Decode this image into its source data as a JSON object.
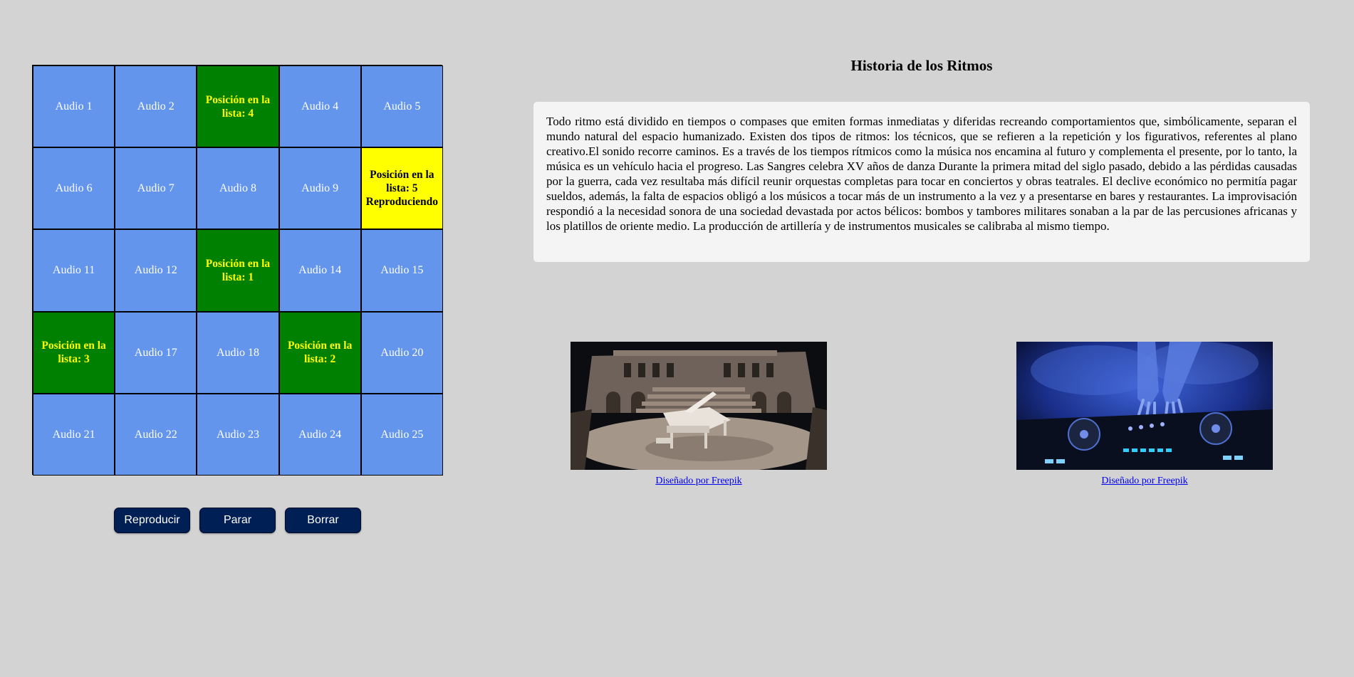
{
  "grid": {
    "cells": [
      {
        "lines": [
          "Audio 1"
        ],
        "state": "idle"
      },
      {
        "lines": [
          "Audio 2"
        ],
        "state": "idle"
      },
      {
        "lines": [
          "Posición en la",
          "lista: 4"
        ],
        "state": "queued"
      },
      {
        "lines": [
          "Audio 4"
        ],
        "state": "idle"
      },
      {
        "lines": [
          "Audio 5"
        ],
        "state": "idle"
      },
      {
        "lines": [
          "Audio 6"
        ],
        "state": "idle"
      },
      {
        "lines": [
          "Audio 7"
        ],
        "state": "idle"
      },
      {
        "lines": [
          "Audio 8"
        ],
        "state": "idle"
      },
      {
        "lines": [
          "Audio 9"
        ],
        "state": "idle"
      },
      {
        "lines": [
          "Posición en la",
          "lista: 5",
          "Reproduciendo"
        ],
        "state": "playing"
      },
      {
        "lines": [
          "Audio 11"
        ],
        "state": "idle"
      },
      {
        "lines": [
          "Audio 12"
        ],
        "state": "idle"
      },
      {
        "lines": [
          "Posición en la",
          "lista: 1"
        ],
        "state": "queued"
      },
      {
        "lines": [
          "Audio 14"
        ],
        "state": "idle"
      },
      {
        "lines": [
          "Audio 15"
        ],
        "state": "idle"
      },
      {
        "lines": [
          "Posición en la",
          "lista: 3"
        ],
        "state": "queued"
      },
      {
        "lines": [
          "Audio 17"
        ],
        "state": "idle"
      },
      {
        "lines": [
          "Audio 18"
        ],
        "state": "idle"
      },
      {
        "lines": [
          "Posición en la",
          "lista: 2"
        ],
        "state": "queued"
      },
      {
        "lines": [
          "Audio 20"
        ],
        "state": "idle"
      },
      {
        "lines": [
          "Audio 21"
        ],
        "state": "idle"
      },
      {
        "lines": [
          "Audio 22"
        ],
        "state": "idle"
      },
      {
        "lines": [
          "Audio 23"
        ],
        "state": "idle"
      },
      {
        "lines": [
          "Audio 24"
        ],
        "state": "idle"
      },
      {
        "lines": [
          "Audio 25"
        ],
        "state": "idle"
      }
    ],
    "colors": {
      "idle": "#6495ed",
      "queued": "#008000",
      "queued_text": "#ffff00",
      "playing": "#ffff00"
    }
  },
  "controls": {
    "play_label": "Reproducir",
    "stop_label": "Parar",
    "clear_label": "Borrar",
    "button_color": "#001f54"
  },
  "article": {
    "title": "Historia de los Ritmos",
    "body": "Todo ritmo está dividido en tiempos o compases que emiten formas inmediatas y diferidas recreando comportamientos que, simbólicamente, separan el mundo natural del espacio humanizado. Existen dos tipos de ritmos: los técnicos, que se refieren a la repetición y los figurativos, referentes al plano creativo.El sonido recorre caminos. Es a través de los tiempos rítmicos como la música nos encamina al futuro y complementa el presente, por lo tanto, la música es un vehículo hacia el progreso. Las Sangres celebra XV años de danza Durante la primera mitad del siglo pasado, debido a las pérdidas causadas por la guerra, cada vez resultaba más difícil reunir orquestas completas para tocar en conciertos y obras teatrales. El declive económico no permitía pagar sueldos, además, la falta de espacios obligó a los músicos a tocar más de un instrumento a la vez y a presentarse en bares y restaurantes. La improvisación respondió a la necesidad sonora de una sociedad devastada por actos bélicos: bombos y tambores militares sonaban a la par de las percusiones africanas y los platillos de oriente medio. La producción de artillería y de instrumentos musicales se calibraba al mismo tiempo."
  },
  "figures": [
    {
      "image": "piano-amphitheater-image",
      "credit": "Diseñado por Freepik"
    },
    {
      "image": "dj-mixer-image",
      "credit": "Diseñado por Freepik"
    }
  ]
}
